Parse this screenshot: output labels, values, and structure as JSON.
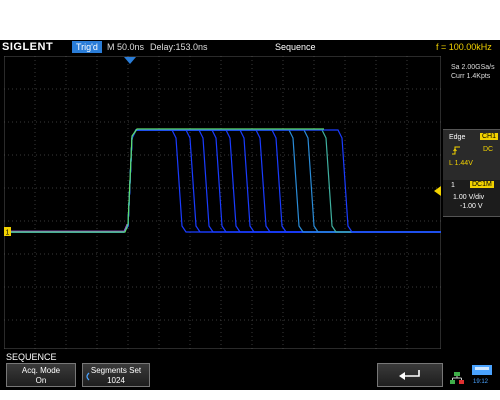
{
  "header": {
    "logo": "SIGLENT",
    "trigger_status": "Trig'd",
    "timebase": "M 50.0ns",
    "delay": "Delay:153.0ns",
    "mode": "Sequence",
    "frequency": "f = 100.00kHz"
  },
  "acquisition": {
    "sample_rate": "Sa 2.00GSa/s",
    "memory": "Curr 1.4Kpts"
  },
  "trigger": {
    "type": "Edge",
    "source": "CH1",
    "slope_icon": "rising-edge-icon",
    "coupling": "DC",
    "level": "L  1.44V"
  },
  "channel": {
    "number": "1",
    "coupling": "DC1M",
    "scale": "1.00 V/div",
    "offset": "-1.00 V"
  },
  "menu": {
    "title": "SEQUENCE",
    "acq_mode_label": "Acq. Mode",
    "acq_mode_value": "On",
    "segments_label": "Segments Set",
    "segments_value": "1024",
    "back_icon": "return-arrow-icon"
  },
  "status": {
    "time": "19:12",
    "network_icon": "network-icon",
    "usb_icon": "usb-icon"
  },
  "colors": {
    "trace_green": "#5ee06a",
    "trace_blue": "#1a3cff",
    "accent_yellow": "#f2d200",
    "trig_blue": "#2a7dd8"
  }
}
